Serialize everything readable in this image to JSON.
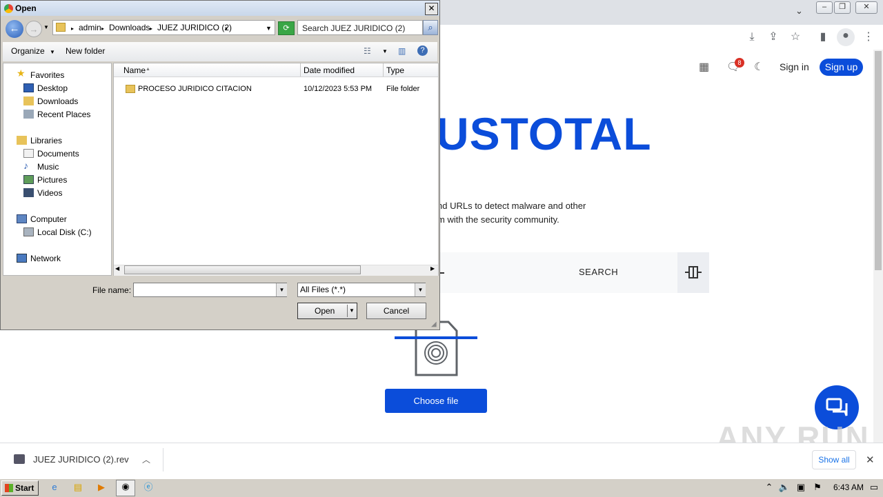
{
  "browser": {
    "toolbar": {
      "download_icon": "download-icon",
      "share_icon": "share-icon",
      "bookmark_icon": "star-icon",
      "sidepanel_icon": "sidepanel-icon",
      "profile_icon": "profile-icon",
      "menu_icon": "kebab-menu-icon"
    },
    "window_controls": [
      "minimize",
      "restore",
      "close"
    ]
  },
  "virustotal": {
    "notification_count": "8",
    "sign_in": "Sign in",
    "sign_up": "Sign up",
    "logo_visible": "USTOTAL",
    "description_line1": "nd URLs to detect malware and other",
    "description_line2": "m with the security community.",
    "search_label": "SEARCH",
    "choose_file": "Choose file",
    "accent_color": "#0b4dda"
  },
  "downloads": {
    "file": "JUEZ JURIDICO (2).rev",
    "show_all": "Show all"
  },
  "watermark": "ANY RUN",
  "taskbar": {
    "start": "Start",
    "clock": "6:43 AM"
  },
  "dialog": {
    "title": "Open",
    "breadcrumbs": [
      "admin",
      "Downloads",
      "JUEZ JURIDICO (2)"
    ],
    "search_placeholder": "Search JUEZ JURIDICO (2)",
    "organize": "Organize",
    "new_folder": "New folder",
    "nav": {
      "favorites": "Favorites",
      "favorites_items": [
        "Desktop",
        "Downloads",
        "Recent Places"
      ],
      "libraries": "Libraries",
      "libraries_items": [
        "Documents",
        "Music",
        "Pictures",
        "Videos"
      ],
      "computer": "Computer",
      "computer_items": [
        "Local Disk (C:)"
      ],
      "network": "Network"
    },
    "columns": [
      "Name",
      "Date modified",
      "Type"
    ],
    "files": [
      {
        "name": "PROCESO JURIDICO CITACION",
        "date": "10/12/2023 5:53 PM",
        "type": "File folder"
      }
    ],
    "file_name_label": "File name:",
    "file_name_value": "",
    "filter": "All Files (*.*)",
    "open": "Open",
    "cancel": "Cancel"
  }
}
